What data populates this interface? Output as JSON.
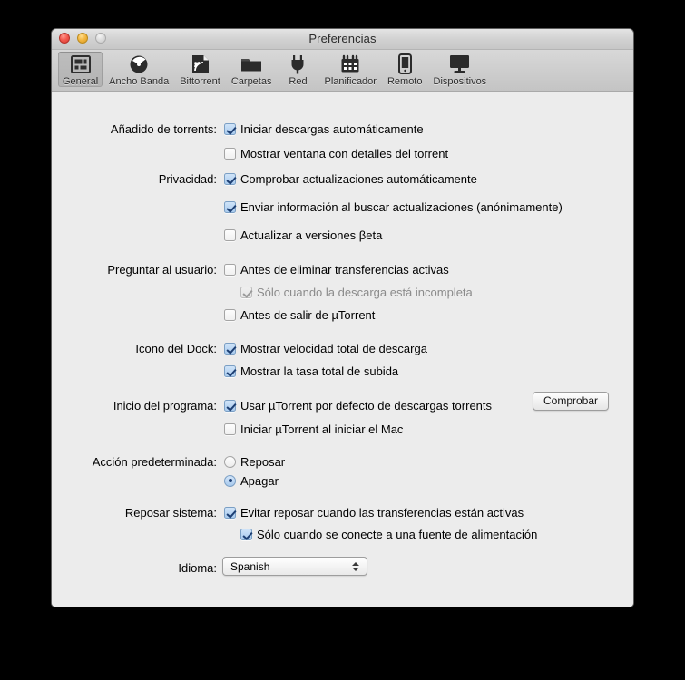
{
  "window": {
    "title": "Preferencias",
    "traffic_lights": [
      {
        "name": "close",
        "color": "#f2584d"
      },
      {
        "name": "minimize",
        "color": "#f2b63f"
      },
      {
        "name": "zoom",
        "color": "#dcdcdc"
      }
    ]
  },
  "toolbar": {
    "items": [
      {
        "label": "General",
        "icon": "general-icon",
        "selected": true
      },
      {
        "label": "Ancho Banda",
        "icon": "bandwidth-icon",
        "selected": false
      },
      {
        "label": "Bittorrent",
        "icon": "bittorrent-icon",
        "selected": false
      },
      {
        "label": "Carpetas",
        "icon": "folder-icon",
        "selected": false
      },
      {
        "label": "Red",
        "icon": "plug-icon",
        "selected": false
      },
      {
        "label": "Planificador",
        "icon": "calendar-icon",
        "selected": false
      },
      {
        "label": "Remoto",
        "icon": "phone-icon",
        "selected": false
      },
      {
        "label": "Dispositivos",
        "icon": "display-icon",
        "selected": false
      }
    ]
  },
  "sections": {
    "torrent_adding": {
      "label": "Añadido de torrents:",
      "options": [
        {
          "label": "Iniciar descargas automáticamente",
          "checked": true,
          "disabled": false,
          "indent": false
        },
        {
          "label": "Mostrar ventana con detalles del torrent",
          "checked": false,
          "disabled": false,
          "indent": false
        }
      ]
    },
    "privacy": {
      "label": "Privacidad:",
      "options": [
        {
          "label": "Comprobar actualizaciones automáticamente",
          "checked": true,
          "disabled": false,
          "indent": false
        },
        {
          "label": "Enviar información al buscar actualizaciones (anónimamente)",
          "checked": true,
          "disabled": false,
          "indent": false
        },
        {
          "label": "Actualizar a versiones βeta",
          "checked": false,
          "disabled": false,
          "indent": false
        }
      ]
    },
    "ask_user": {
      "label": "Preguntar al usuario:",
      "options": [
        {
          "label": "Antes de eliminar transferencias activas",
          "checked": false,
          "disabled": false,
          "indent": false
        },
        {
          "label": "Sólo cuando la descarga está incompleta",
          "checked": true,
          "disabled": true,
          "indent": true
        },
        {
          "label": "Antes de salir de µTorrent",
          "checked": false,
          "disabled": false,
          "indent": false
        }
      ]
    },
    "dock_icon": {
      "label": "Icono del Dock:",
      "options": [
        {
          "label": "Mostrar velocidad total de descarga",
          "checked": true,
          "disabled": false,
          "indent": false
        },
        {
          "label": "Mostrar la tasa total de subida",
          "checked": true,
          "disabled": false,
          "indent": false
        }
      ]
    },
    "program_start": {
      "label": "Inicio del programa:",
      "options": [
        {
          "label": "Usar µTorrent por defecto de descargas torrents",
          "checked": true,
          "disabled": false,
          "indent": false
        },
        {
          "label": "Iniciar µTorrent al iniciar el Mac",
          "checked": false,
          "disabled": false,
          "indent": false
        }
      ],
      "button": "Comprobar"
    },
    "default_action": {
      "label": "Acción predeterminada:",
      "options": [
        {
          "label": "Reposar",
          "selected": false
        },
        {
          "label": "Apagar",
          "selected": true
        }
      ]
    },
    "system_sleep": {
      "label": "Reposar sistema:",
      "options": [
        {
          "label": "Evitar reposar cuando las transferencias están activas",
          "checked": true,
          "disabled": false,
          "indent": false
        },
        {
          "label": "Sólo cuando se conecte a una fuente de alimentación",
          "checked": true,
          "disabled": false,
          "indent": true
        }
      ]
    },
    "language": {
      "label": "Idioma:",
      "value": "Spanish"
    }
  }
}
